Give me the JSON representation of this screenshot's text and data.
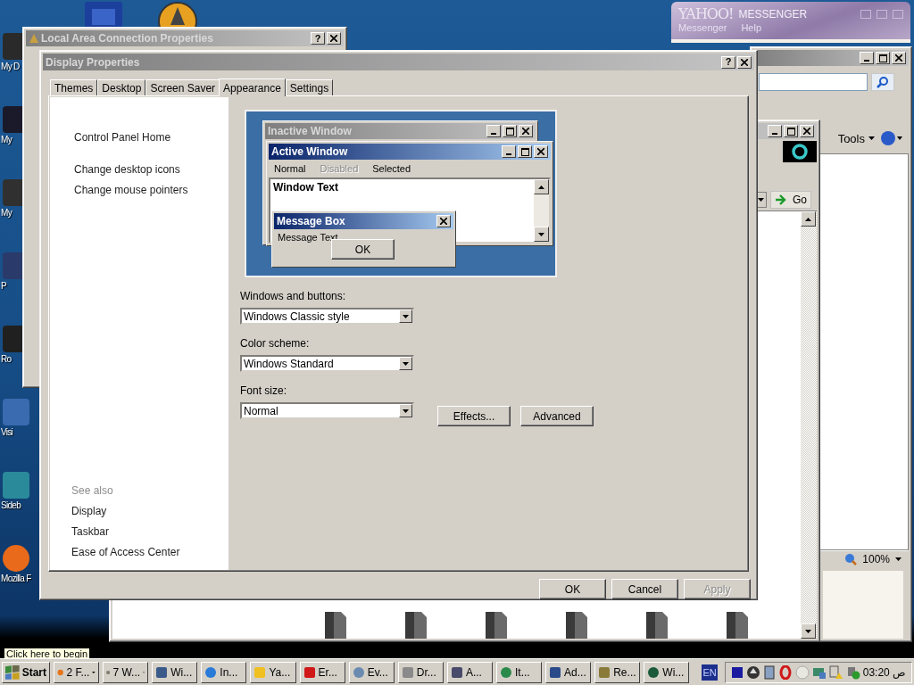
{
  "desktop_icons": [
    {
      "label": "My D"
    },
    {
      "label": "My"
    },
    {
      "label": "My"
    },
    {
      "label": "P"
    },
    {
      "label": "Ro"
    },
    {
      "label": "Visi"
    },
    {
      "label": "Sideb"
    },
    {
      "label": "Mozilla F"
    }
  ],
  "yahoo": {
    "logo": "YAHOO!",
    "title": "MESSENGER",
    "menu": [
      "Messenger",
      "Help"
    ]
  },
  "browser": {
    "tools": "Tools",
    "zoom": "100%"
  },
  "explorer": {
    "go": "Go"
  },
  "lan_window": {
    "title": "Local Area Connection Properties",
    "help": "?"
  },
  "display": {
    "title": "Display Properties",
    "help": "?",
    "tabs": [
      {
        "label": "Themes",
        "selected": false
      },
      {
        "label": "Desktop",
        "selected": false
      },
      {
        "label": "Screen Saver",
        "selected": false
      },
      {
        "label": "Appearance",
        "selected": true
      },
      {
        "label": "Settings",
        "selected": false
      }
    ],
    "sidebar": {
      "links": [
        "Control Panel Home",
        "Change desktop icons",
        "Change mouse pointers"
      ],
      "see_also_heading": "See also",
      "see_also": [
        "Display",
        "Taskbar",
        "Ease of Access Center"
      ]
    },
    "preview": {
      "inactive_title": "Inactive Window",
      "active_title": "Active Window",
      "menu": [
        {
          "label": "Normal",
          "kind": "normal"
        },
        {
          "label": "Disabled",
          "kind": "disabled"
        },
        {
          "label": "Selected",
          "kind": "selected"
        }
      ],
      "window_text": "Window Text",
      "message_title": "Message Box",
      "message_text": "Message Text",
      "message_button": "OK"
    },
    "settings": [
      {
        "label": "Windows and buttons:",
        "value": "Windows Classic style"
      },
      {
        "label": "Color scheme:",
        "value": "Windows Standard"
      },
      {
        "label": "Font size:",
        "value": "Normal"
      }
    ],
    "action_buttons": [
      "Effects...",
      "Advanced"
    ],
    "dialog_buttons": [
      {
        "label": "OK",
        "disabled": false
      },
      {
        "label": "Cancel",
        "disabled": false
      },
      {
        "label": "Apply",
        "disabled": true
      }
    ]
  },
  "tooltip": "Click here to begin",
  "taskbar": {
    "start": "Start",
    "buttons": [
      {
        "label": "2 F...",
        "kind": "group"
      },
      {
        "label": "7 W...",
        "kind": "group"
      },
      {
        "label": "Wi...",
        "kind": "single"
      },
      {
        "label": "In...",
        "kind": "single"
      },
      {
        "label": "Ya...",
        "kind": "single"
      },
      {
        "label": "Er...",
        "kind": "single"
      },
      {
        "label": "Ev...",
        "kind": "single"
      },
      {
        "label": "Dr...",
        "kind": "single"
      },
      {
        "label": "A...",
        "kind": "single"
      },
      {
        "label": "It...",
        "kind": "single"
      },
      {
        "label": "Ad...",
        "kind": "single"
      },
      {
        "label": "Re...",
        "kind": "single"
      },
      {
        "label": "Wi...",
        "kind": "single"
      }
    ],
    "language": "EN",
    "clock": "03:20 ص"
  }
}
